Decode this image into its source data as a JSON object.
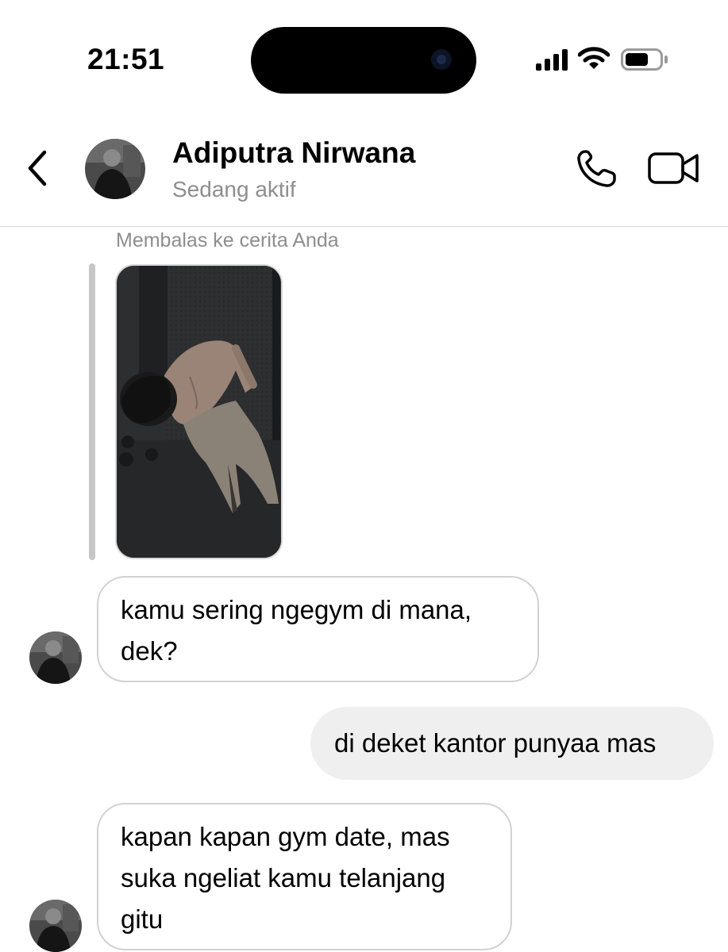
{
  "status_bar": {
    "time": "21:51"
  },
  "header": {
    "contact_name": "Adiputra Nirwana",
    "contact_status": "Sedang aktif"
  },
  "story_reply": {
    "label": "Membalas ke cerita Anda"
  },
  "messages": [
    {
      "direction": "incoming",
      "text": "kamu sering ngegym di mana, dek?"
    },
    {
      "direction": "outgoing",
      "text": "di deket kantor punyaa mas"
    },
    {
      "direction": "incoming",
      "text": "kapan kapan gym date, mas suka ngeliat kamu telanjang gitu"
    }
  ],
  "icons": {
    "back": "chevron-left-icon",
    "phone": "phone-icon",
    "video": "video-camera-icon",
    "signal": "cellular-signal-icon",
    "wifi": "wifi-icon",
    "battery": "battery-icon"
  },
  "colors": {
    "secondary_text": "#8e8e8e",
    "incoming_border": "#d2d2d2",
    "outgoing_bg": "#efefef",
    "divider": "#dbdbdb"
  }
}
